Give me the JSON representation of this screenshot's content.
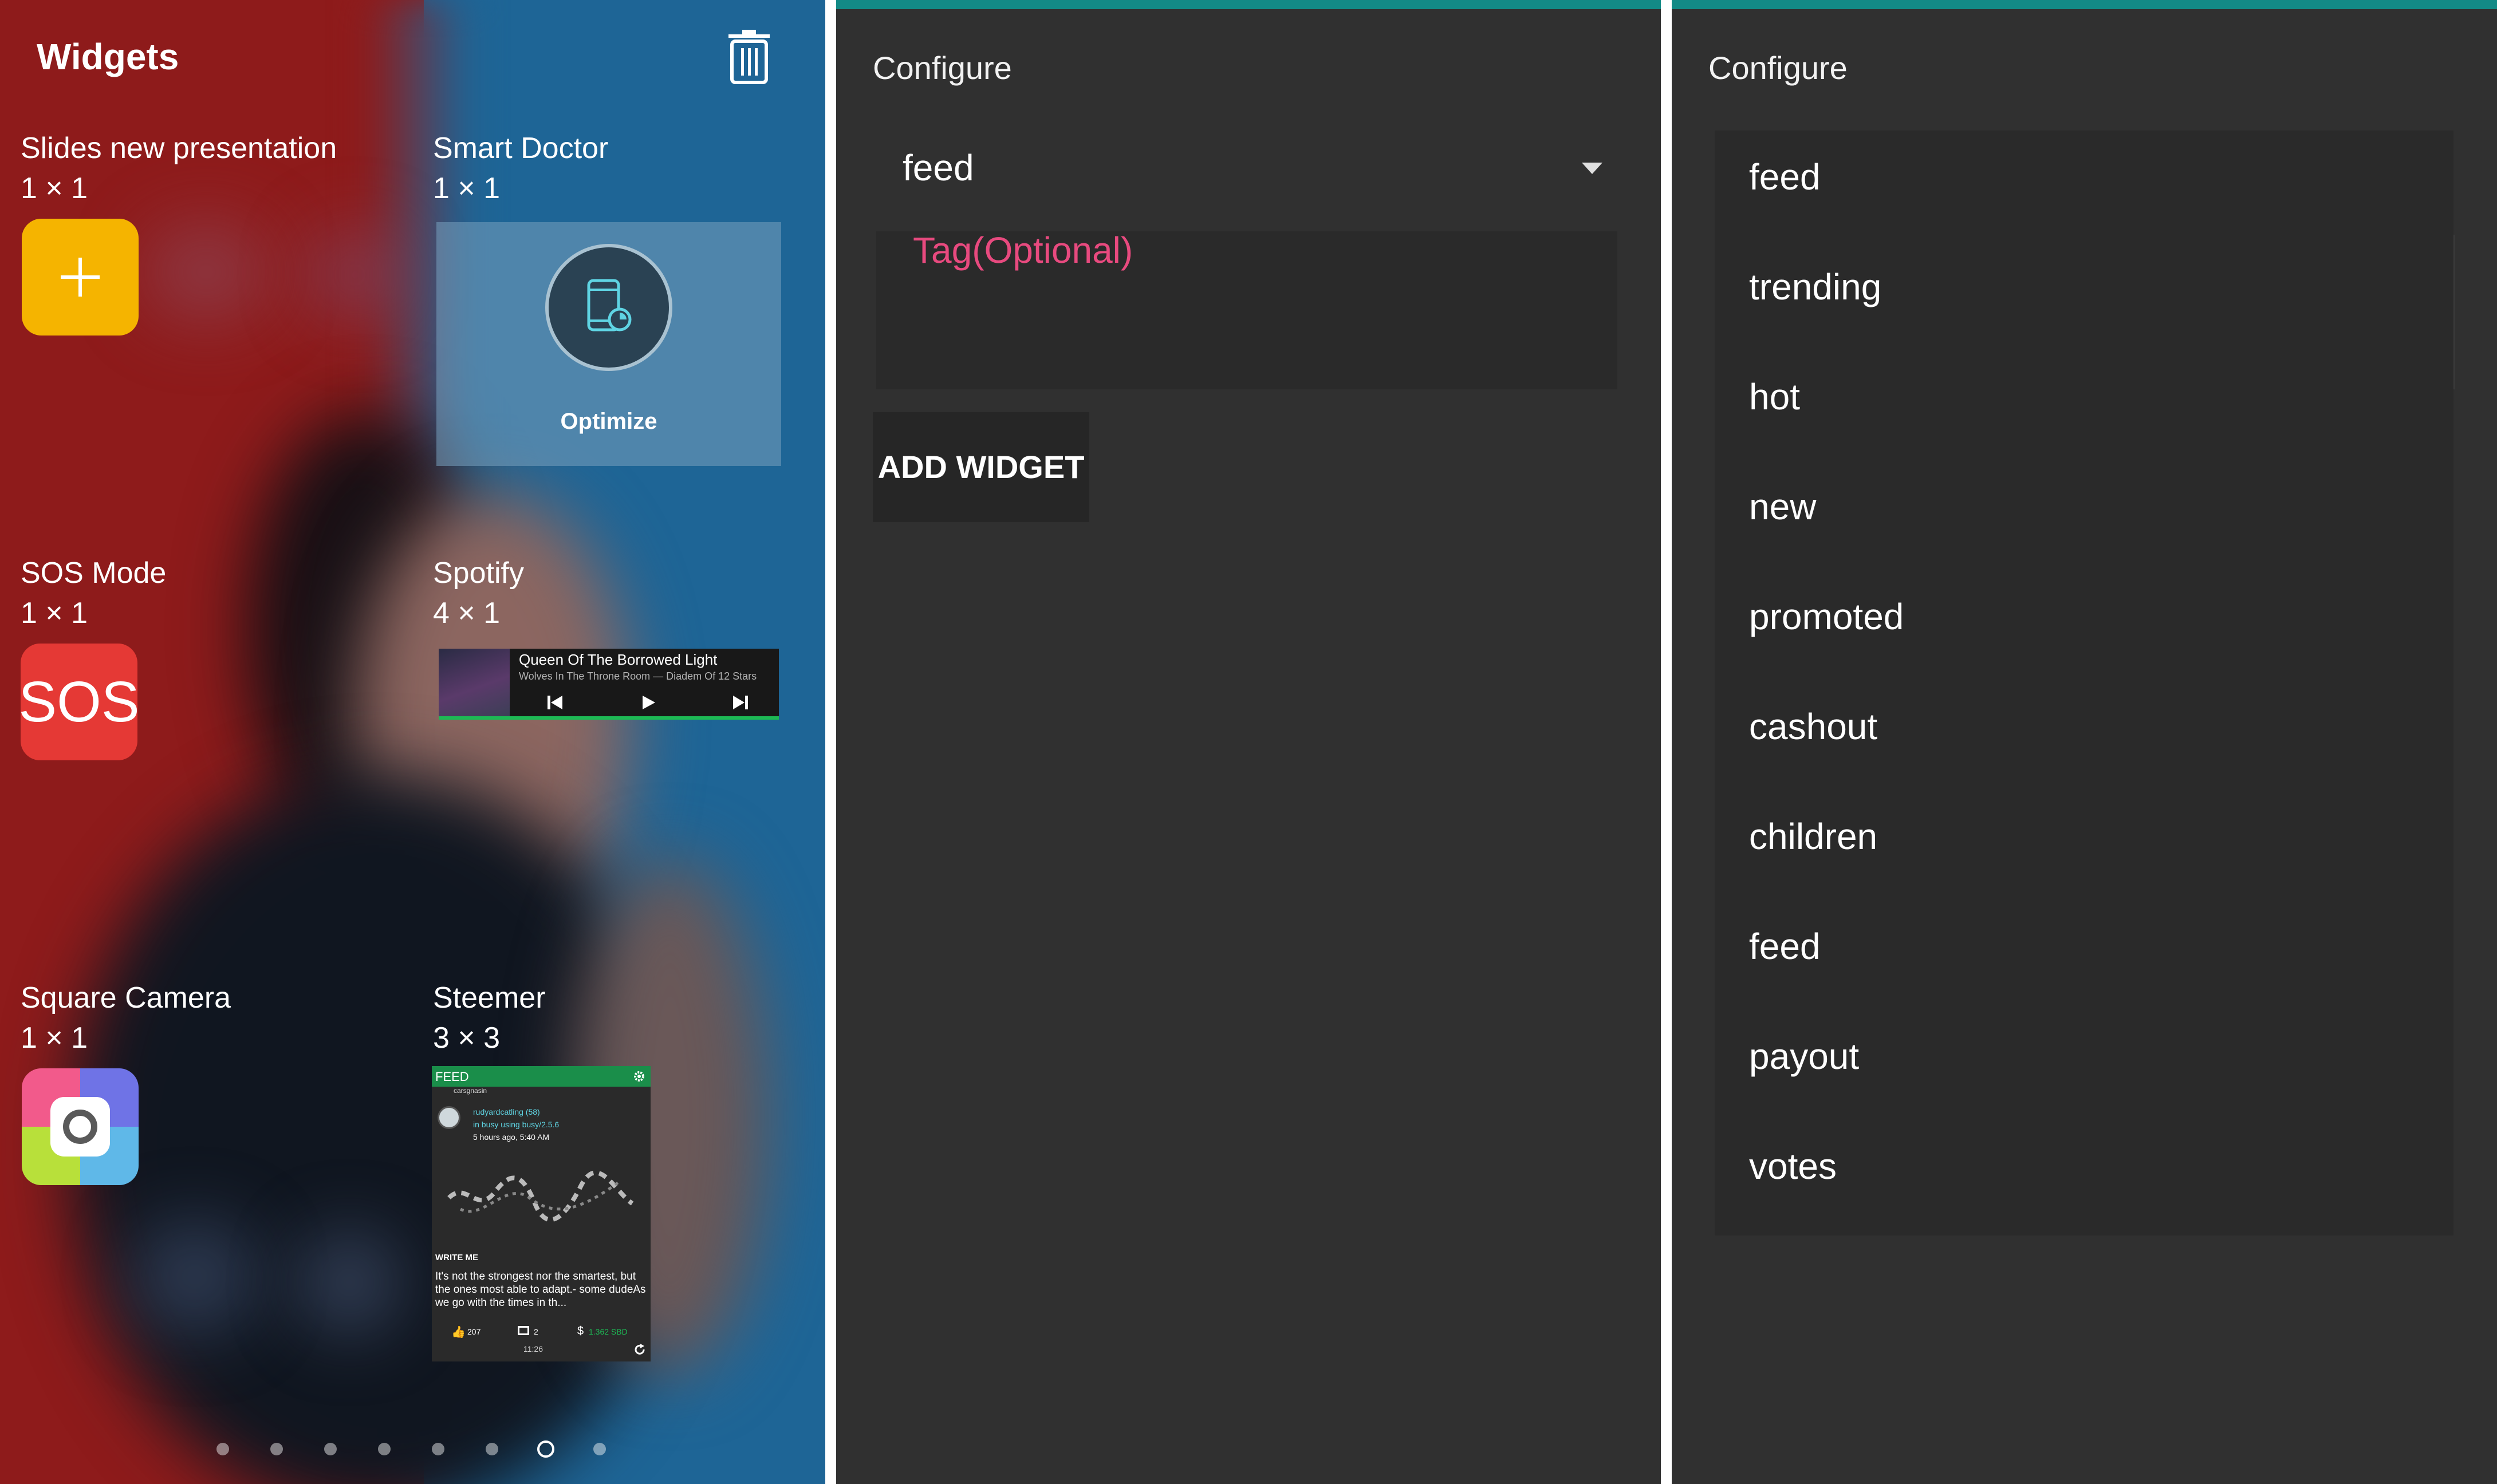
{
  "widgets_screen": {
    "title": "Widgets",
    "widgets": [
      {
        "name": "Slides new presentation",
        "size": "1 × 1"
      },
      {
        "name": "Smart Doctor",
        "size": "1 × 1",
        "preview_label": "Optimize"
      },
      {
        "name": "SOS Mode",
        "size": "1 × 1",
        "preview_label": "SOS"
      },
      {
        "name": "Spotify",
        "size": "4 × 1"
      },
      {
        "name": "Square Camera",
        "size": "1 × 1"
      },
      {
        "name": "Steemer",
        "size": "3 × 3"
      }
    ],
    "spotify_preview": {
      "track": "Queen Of The Borrowed Light",
      "subtitle": "Wolves In The Throne Room — Diadem Of 12 Stars"
    },
    "steemer_preview": {
      "header": "FEED",
      "reblog_user": "carsgnasin",
      "author": "rudyardcatling (58)",
      "app": "in busy using busy/2.5.6",
      "time": "5 hours ago, 5:40 AM",
      "post_title": "WRITE ME",
      "excerpt": "It's not the strongest nor the smartest, but the ones most able to adapt.- some dudeAs we go with the times in th...",
      "votes": "207",
      "comments": "2",
      "payout": "1.362 SBD",
      "clock": "11:26"
    },
    "page_dots": {
      "count": 8,
      "active_index": 6
    },
    "colors": {
      "wall_red": "#8e1b1b",
      "wall_blue": "#1e6596",
      "spotify_green": "#1db954",
      "steemer_green": "#1a8e4a"
    }
  },
  "configure_screen": {
    "title": "Configure",
    "selected_tag_type": "feed",
    "tag_placeholder": "Tag(Optional)",
    "add_button": "ADD WIDGET",
    "colors": {
      "accent": "#138a86",
      "hint": "#e84a7f",
      "background": "#303030"
    }
  },
  "configure_dropdown": {
    "title": "Configure",
    "options": [
      "feed",
      "trending",
      "hot",
      "new",
      "promoted",
      "cashout",
      "children",
      "feed",
      "payout",
      "votes"
    ]
  }
}
